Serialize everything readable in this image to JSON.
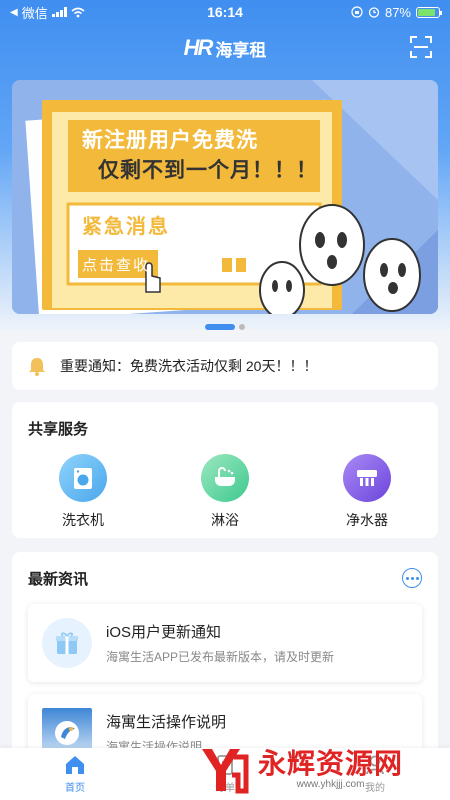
{
  "status_bar": {
    "carrier": "微信",
    "time": "16:14",
    "battery": "87%"
  },
  "header": {
    "logo_mark": "HR",
    "app_name": "海享租"
  },
  "banner": {
    "headline_line1": "新注册用户免费洗",
    "headline_line2": "仅剩不到一个月！！！",
    "tag": "紧急消息",
    "cta": "点击查收"
  },
  "notice": {
    "text": "重要通知：免费洗衣活动仅剩 20天！！！"
  },
  "services": {
    "title": "共享服务",
    "items": [
      {
        "label": "洗衣机",
        "icon": "washing-machine-icon",
        "color": "#5fb5f2"
      },
      {
        "label": "淋浴",
        "icon": "shower-icon",
        "color": "#5dd6a0"
      },
      {
        "label": "净水器",
        "icon": "water-purifier-icon",
        "color": "#8a63ea"
      }
    ]
  },
  "news": {
    "title": "最新资讯",
    "items": [
      {
        "title": "iOS用户更新通知",
        "subtitle": "海寓生活APP已发布最新版本，请及时更新",
        "icon": "gift-icon"
      },
      {
        "title": "海寓生活操作说明",
        "subtitle": "海寓生活操作说明",
        "icon": "guide-thumbnail"
      }
    ]
  },
  "tabbar": {
    "items": [
      {
        "label": "首页",
        "active": true
      },
      {
        "label": "订单",
        "active": false
      },
      {
        "label": "我的",
        "active": false
      }
    ]
  },
  "watermark": {
    "text": "永辉资源网",
    "url": "www.yhkjjj.com"
  },
  "colors": {
    "accent": "#3f8ef0",
    "banner_yellow": "#f3b93a"
  }
}
